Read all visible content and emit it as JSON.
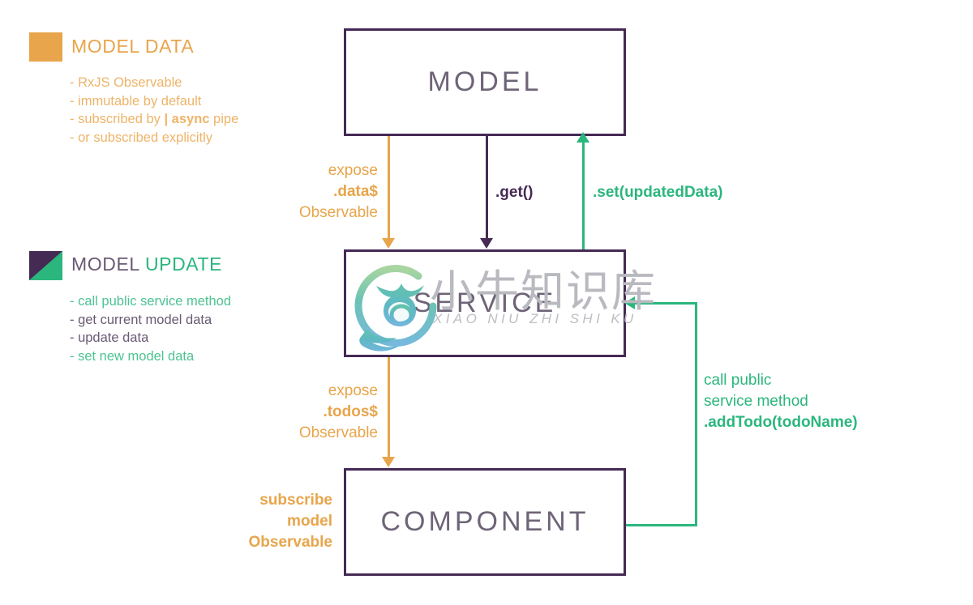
{
  "colors": {
    "orange": "#e8a54b",
    "orange_light": "#eeb469",
    "purple": "#452a54",
    "purple_muted": "#6a5a74",
    "green": "#2bb67e",
    "green_light": "#4cc392",
    "node_text": "#6e6477",
    "background": "#ffffff"
  },
  "legend": [
    {
      "swatch": "solid-orange",
      "title_parts": [
        {
          "text": "MODEL DATA",
          "color": "orange"
        }
      ],
      "items": [
        {
          "text": "- RxJS Observable",
          "color": "orange"
        },
        {
          "text": "- immutable by default",
          "color": "orange"
        },
        {
          "text": "- subscribed by | async pipe",
          "color": "orange",
          "bold_fragment": "| async"
        },
        {
          "text": "- or subscribed explicitly",
          "color": "orange"
        }
      ]
    },
    {
      "swatch": "split-purple-green",
      "title_parts": [
        {
          "text": "MODEL",
          "color": "purple"
        },
        {
          "text": " UPDATE",
          "color": "green"
        }
      ],
      "items": [
        {
          "text": "- call public service method",
          "color": "green"
        },
        {
          "text": "- get current model data",
          "color": "purple"
        },
        {
          "text": "- update data",
          "color": "purple"
        },
        {
          "text": "- set new model data",
          "color": "green"
        }
      ]
    }
  ],
  "nodes": {
    "model": "MODEL",
    "service": "SERVICE",
    "component": "COMPONENT"
  },
  "edges": {
    "expose_data": {
      "lines": [
        "expose",
        ".data$",
        "Observable"
      ],
      "bold_line": 1,
      "color": "orange"
    },
    "get": {
      "lines": [
        ".get()"
      ],
      "bold_line": 0,
      "color": "purple"
    },
    "set": {
      "lines": [
        ".set(updatedData)"
      ],
      "bold_line": 0,
      "color": "green"
    },
    "expose_todos": {
      "lines": [
        "expose",
        ".todos$",
        "Observable"
      ],
      "bold_line": 1,
      "color": "orange"
    },
    "subscribe": {
      "lines": [
        "subscribe",
        "model",
        "Observable"
      ],
      "all_bold": true,
      "color": "orange"
    },
    "call_service": {
      "lines": [
        "call public",
        "service method",
        ".addTodo(todoName)"
      ],
      "bold_line": 2,
      "color": "green"
    }
  },
  "watermark": {
    "chinese": "小牛知识库",
    "pinyin": "XIAO NIU ZHI SHI KU"
  }
}
